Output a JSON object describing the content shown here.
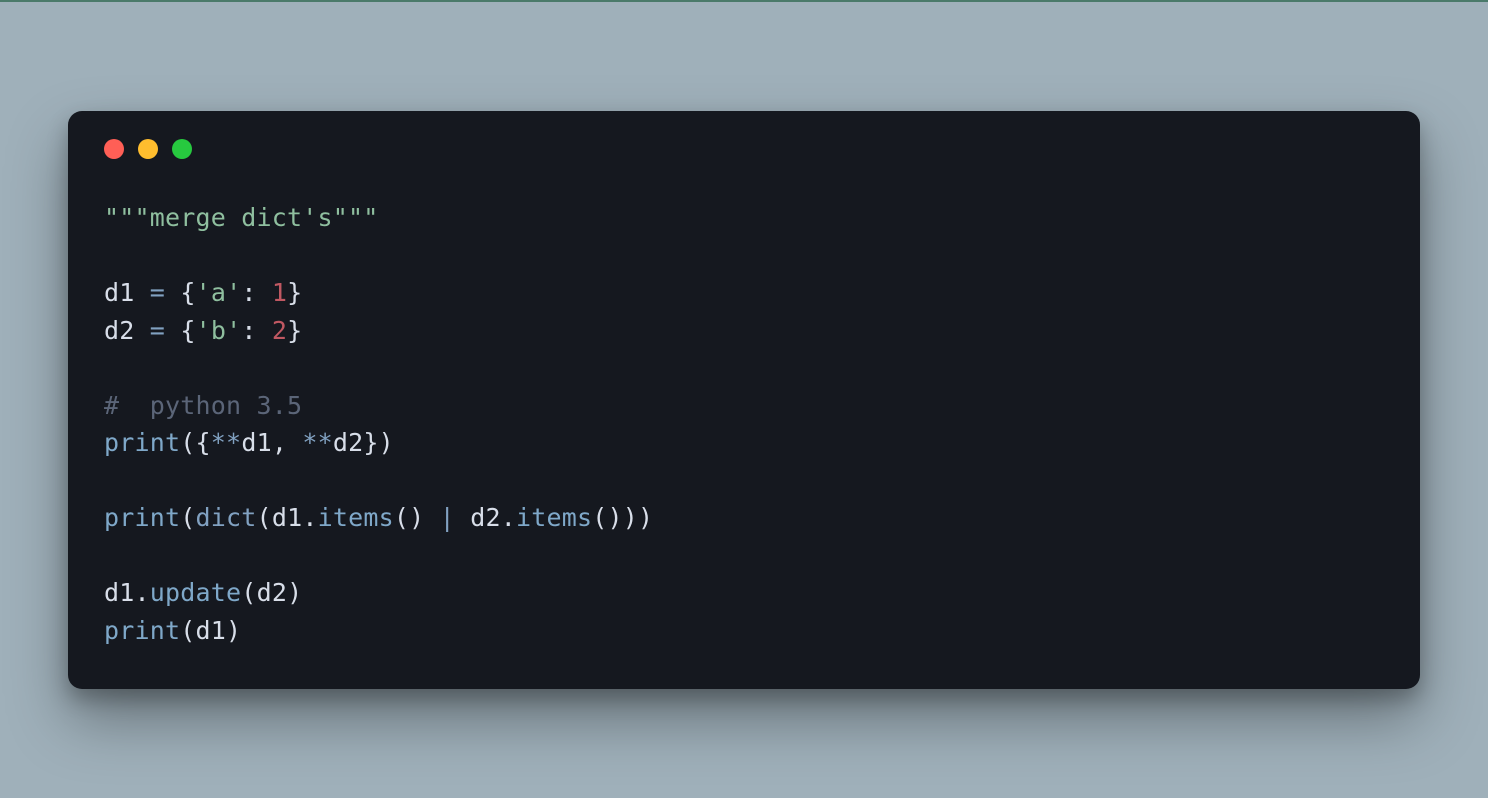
{
  "window": {
    "traffic_lights": {
      "red": "#ff5f56",
      "yellow": "#ffbd2e",
      "green": "#27c93f"
    }
  },
  "code": {
    "tokens": [
      [
        {
          "text": "\"\"\"merge dict's\"\"\"",
          "cls": "tok-str"
        }
      ],
      [],
      [
        {
          "text": "d1",
          "cls": "tok-var"
        },
        {
          "text": " ",
          "cls": "tok-var"
        },
        {
          "text": "=",
          "cls": "tok-op"
        },
        {
          "text": " ",
          "cls": "tok-var"
        },
        {
          "text": "{",
          "cls": "tok-punc"
        },
        {
          "text": "'a'",
          "cls": "tok-key"
        },
        {
          "text": ":",
          "cls": "tok-punc"
        },
        {
          "text": " ",
          "cls": "tok-var"
        },
        {
          "text": "1",
          "cls": "tok-num"
        },
        {
          "text": "}",
          "cls": "tok-punc"
        }
      ],
      [
        {
          "text": "d2",
          "cls": "tok-var"
        },
        {
          "text": " ",
          "cls": "tok-var"
        },
        {
          "text": "=",
          "cls": "tok-op"
        },
        {
          "text": " ",
          "cls": "tok-var"
        },
        {
          "text": "{",
          "cls": "tok-punc"
        },
        {
          "text": "'b'",
          "cls": "tok-key"
        },
        {
          "text": ":",
          "cls": "tok-punc"
        },
        {
          "text": " ",
          "cls": "tok-var"
        },
        {
          "text": "2",
          "cls": "tok-num"
        },
        {
          "text": "}",
          "cls": "tok-punc"
        }
      ],
      [],
      [
        {
          "text": "#  python 3.5",
          "cls": "tok-com"
        }
      ],
      [
        {
          "text": "print",
          "cls": "tok-fn"
        },
        {
          "text": "(",
          "cls": "tok-punc"
        },
        {
          "text": "{",
          "cls": "tok-punc"
        },
        {
          "text": "**",
          "cls": "tok-unpack"
        },
        {
          "text": "d1",
          "cls": "tok-var"
        },
        {
          "text": ",",
          "cls": "tok-punc"
        },
        {
          "text": " ",
          "cls": "tok-var"
        },
        {
          "text": "**",
          "cls": "tok-unpack"
        },
        {
          "text": "d2",
          "cls": "tok-var"
        },
        {
          "text": "}",
          "cls": "tok-punc"
        },
        {
          "text": ")",
          "cls": "tok-punc"
        }
      ],
      [],
      [
        {
          "text": "print",
          "cls": "tok-fn"
        },
        {
          "text": "(",
          "cls": "tok-punc"
        },
        {
          "text": "dict",
          "cls": "tok-builtin"
        },
        {
          "text": "(",
          "cls": "tok-punc"
        },
        {
          "text": "d1",
          "cls": "tok-var"
        },
        {
          "text": ".",
          "cls": "tok-punc"
        },
        {
          "text": "items",
          "cls": "tok-attr"
        },
        {
          "text": "(",
          "cls": "tok-punc"
        },
        {
          "text": ")",
          "cls": "tok-punc"
        },
        {
          "text": " ",
          "cls": "tok-var"
        },
        {
          "text": "|",
          "cls": "tok-op"
        },
        {
          "text": " ",
          "cls": "tok-var"
        },
        {
          "text": "d2",
          "cls": "tok-var"
        },
        {
          "text": ".",
          "cls": "tok-punc"
        },
        {
          "text": "items",
          "cls": "tok-attr"
        },
        {
          "text": "(",
          "cls": "tok-punc"
        },
        {
          "text": ")",
          "cls": "tok-punc"
        },
        {
          "text": ")",
          "cls": "tok-punc"
        },
        {
          "text": ")",
          "cls": "tok-punc"
        }
      ],
      [],
      [
        {
          "text": "d1",
          "cls": "tok-var"
        },
        {
          "text": ".",
          "cls": "tok-punc"
        },
        {
          "text": "update",
          "cls": "tok-attr"
        },
        {
          "text": "(",
          "cls": "tok-punc"
        },
        {
          "text": "d2",
          "cls": "tok-var"
        },
        {
          "text": ")",
          "cls": "tok-punc"
        }
      ],
      [
        {
          "text": "print",
          "cls": "tok-fn"
        },
        {
          "text": "(",
          "cls": "tok-punc"
        },
        {
          "text": "d1",
          "cls": "tok-var"
        },
        {
          "text": ")",
          "cls": "tok-punc"
        }
      ]
    ]
  }
}
